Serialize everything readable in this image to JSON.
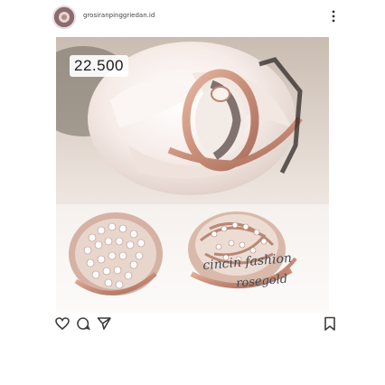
{
  "post": {
    "username": "grosiranpinggriedan.id",
    "price": "22.500",
    "overlay_caption": {
      "line1": "cincin fashion",
      "line2": "rosegold"
    }
  },
  "icons": {
    "more": "more-vertical-icon",
    "like": "heart-icon",
    "comment": "comment-icon",
    "share": "share-icon",
    "save": "bookmark-icon"
  },
  "colors": {
    "accent": "#c9908a",
    "rosegold": "#c88d77",
    "background": "#ffffff"
  }
}
